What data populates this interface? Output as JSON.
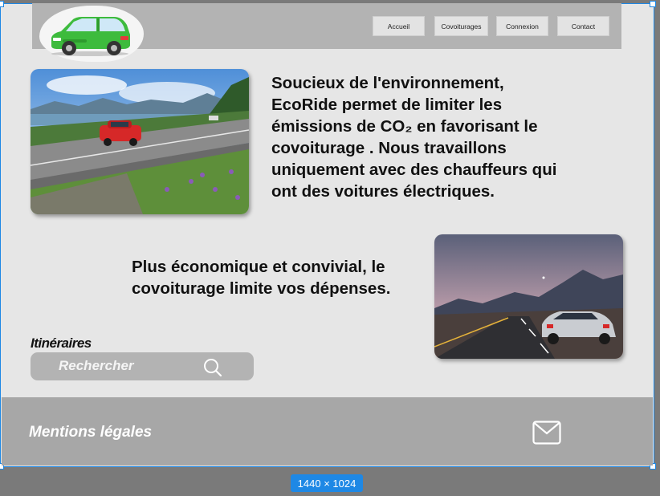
{
  "nav": {
    "items": [
      {
        "label": "Accueil"
      },
      {
        "label": "Covoiturages"
      },
      {
        "label": "Connexion"
      },
      {
        "label": "Contact"
      }
    ]
  },
  "hero": {
    "text": "Soucieux de l'environnement, EcoRide permet de limiter les émissions de CO₂ en favorisant le covoiturage . Nous travaillons uniquement avec des chauffeurs qui ont des voitures électriques."
  },
  "section2": {
    "text": "Plus économique et convivial, le covoiturage limite vos dépenses."
  },
  "search": {
    "title": "Itinéraires",
    "placeholder": "Rechercher"
  },
  "footer": {
    "legal_label": "Mentions légales"
  },
  "canvas": {
    "size_label": "1440 × 1024"
  },
  "colors": {
    "brand_green": "#3dbb3d",
    "selection_blue": "#1e88e5"
  }
}
